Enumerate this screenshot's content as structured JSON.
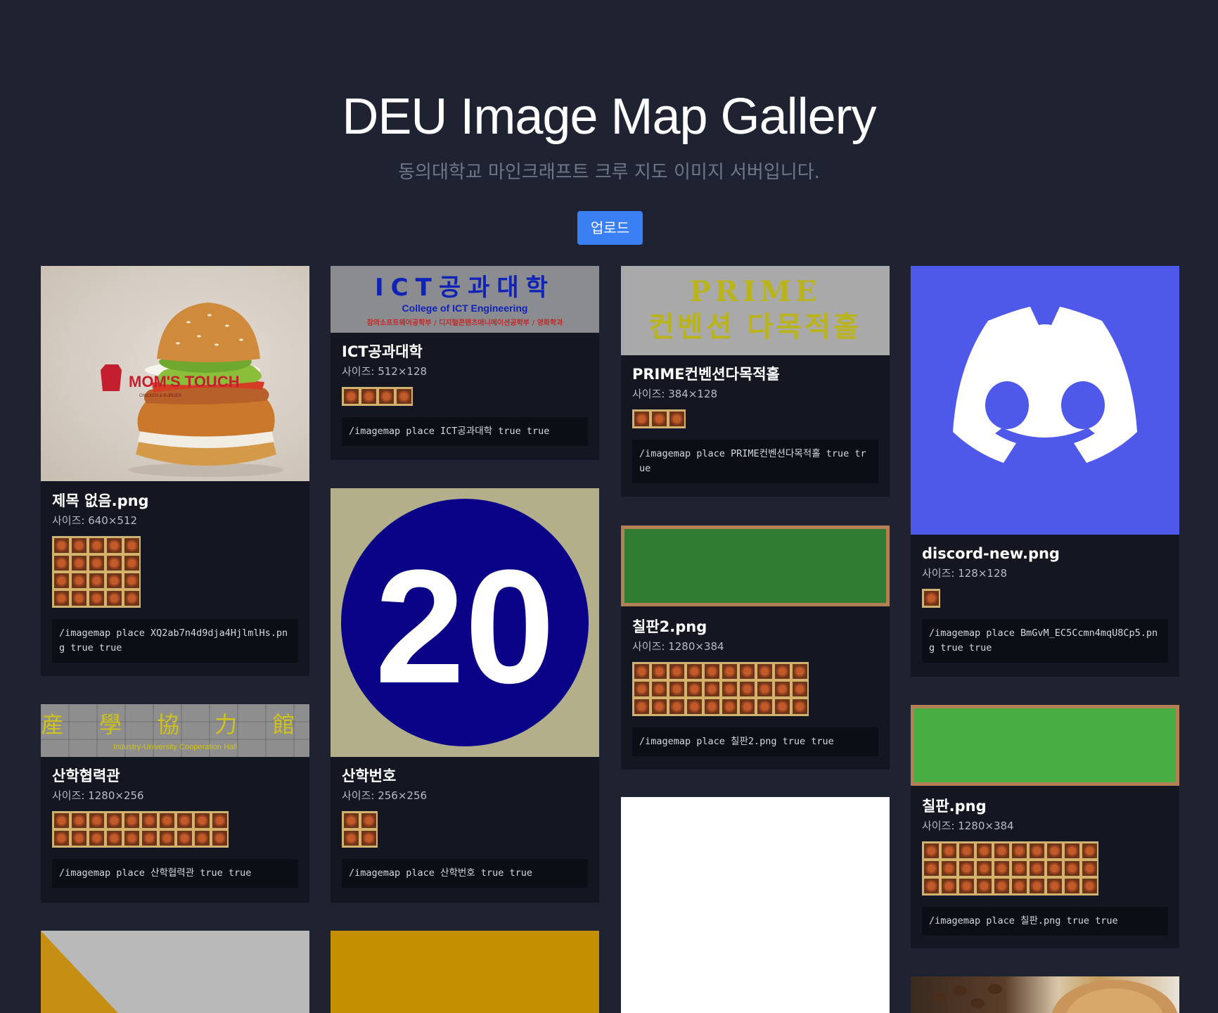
{
  "header": {
    "title": "DEU Image Map Gallery",
    "subtitle": "동의대학교 마인크래프트 크루 지도 이미지 서버입니다.",
    "upload_label": "업로드"
  },
  "cards": [
    {
      "name": "제목 없음.png",
      "size": "사이즈: 640×512",
      "command": "/imagemap place XQ2ab7n4d9dja4HjlmlHs.png true true",
      "grid": [
        5,
        4
      ],
      "logo_text": "MOM'S TOUCH",
      "logo_sub": "CHICKEN & BURGER"
    },
    {
      "name": "ICT공과대학",
      "size": "사이즈: 512×128",
      "command": "/imagemap place ICT공과대학 true true",
      "grid": [
        4,
        1
      ],
      "banner_title": "ICT공과대학",
      "banner_sub": "College of ICT Engineering",
      "banner_dept": "참의소프트웨어공학부 / 디지털콘텐츠애니메이션공학부 / 영화학과"
    },
    {
      "name": "PRIME컨벤션다목적홀",
      "size": "사이즈: 384×128",
      "command": "/imagemap place PRIME컨벤션다목적홀 true true",
      "grid": [
        3,
        1
      ],
      "banner_title": "PRIME",
      "banner_sub": "컨벤션 다목적홀"
    },
    {
      "name": "discord-new.png",
      "size": "사이즈: 128×128",
      "command": "/imagemap place BmGvM_EC5Ccmn4mqU8Cp5.png true true",
      "grid": [
        1,
        1
      ]
    },
    {
      "name": "산학협력관",
      "size": "사이즈: 1280×256",
      "command": "/imagemap place 산학협력관 true true",
      "grid": [
        10,
        2
      ],
      "banner_title": "産 學 協 力 館",
      "banner_sub": "Industry-University Cooperation Hall"
    },
    {
      "name": "산학번호",
      "size": "사이즈: 256×256",
      "command": "/imagemap place 산학번호 true true",
      "grid": [
        2,
        2
      ],
      "number": "20"
    },
    {
      "name": "칠판2.png",
      "size": "사이즈: 1280×384",
      "command": "/imagemap place 칠판2.png true true",
      "grid": [
        10,
        3
      ]
    },
    {
      "name": "칠판.png",
      "size": "사이즈: 1280×384",
      "command": "/imagemap place 칠판.png true true",
      "grid": [
        10,
        3
      ]
    }
  ],
  "colors": {
    "background": "#1f2231",
    "card": "#141722",
    "accent": "#3b7ff5",
    "discord": "#4e58e9",
    "chalkboard_dark": "#2e7d32",
    "chalkboard_light": "#46ae42",
    "number_circle": "#0b0387"
  }
}
